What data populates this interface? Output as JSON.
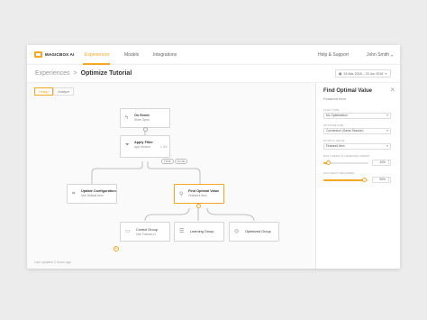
{
  "app": {
    "brand": "MAGICBOX AI"
  },
  "nav": {
    "experiences": "Experiences",
    "models": "Models",
    "integrations": "Integrations",
    "help": "Help & Support",
    "user": "John Smith"
  },
  "header": {
    "crumb_parent": "Experiences",
    "crumb_sep": ">",
    "title": "Optimize Tutorial",
    "date_range": "24 Mar 2018 – 23 Jun 2018"
  },
  "tabs": [
    {
      "label": "Design"
    },
    {
      "label": "Analyze"
    }
  ],
  "nodes": {
    "on_event": {
      "title": "On Event",
      "sub": "Store Open"
    },
    "apply_filter": {
      "title": "Apply Filter",
      "sub": "App Version",
      "extra": "> 4.0"
    },
    "update_config": {
      "title": "Update Configuration",
      "sub": "Use Default Item"
    },
    "find_optimal": {
      "title": "Find Optimal Value",
      "sub": "Featured Item"
    },
    "control_group": {
      "title": "Control Group",
      "sub": "Use Tutorial v1"
    },
    "learning_group": {
      "title": "Learning Group"
    },
    "optimized_group": {
      "title": "Optimized Group"
    }
  },
  "branch_pills": [
    "TRUE",
    "FALSE"
  ],
  "add_symbol": "+",
  "last_updated": "Last updated 2 hours ago",
  "panel": {
    "title": "Find Optimal Value",
    "subtitle": "Featured Item",
    "fields": [
      {
        "label": "Algo Type",
        "value": "ML Optimization"
      },
      {
        "label": "Optimize For",
        "value": "Conversion (Game Session)"
      },
      {
        "label": "Output Value",
        "value": "Featured Item"
      }
    ],
    "sliders": [
      {
        "label": "Max Users in Learning Group",
        "value": "10%",
        "fraction": 0.1
      },
      {
        "label": "Accuracy Required",
        "value": "90%",
        "fraction": 0.9
      }
    ]
  },
  "colors": {
    "accent": "#f5a623"
  }
}
